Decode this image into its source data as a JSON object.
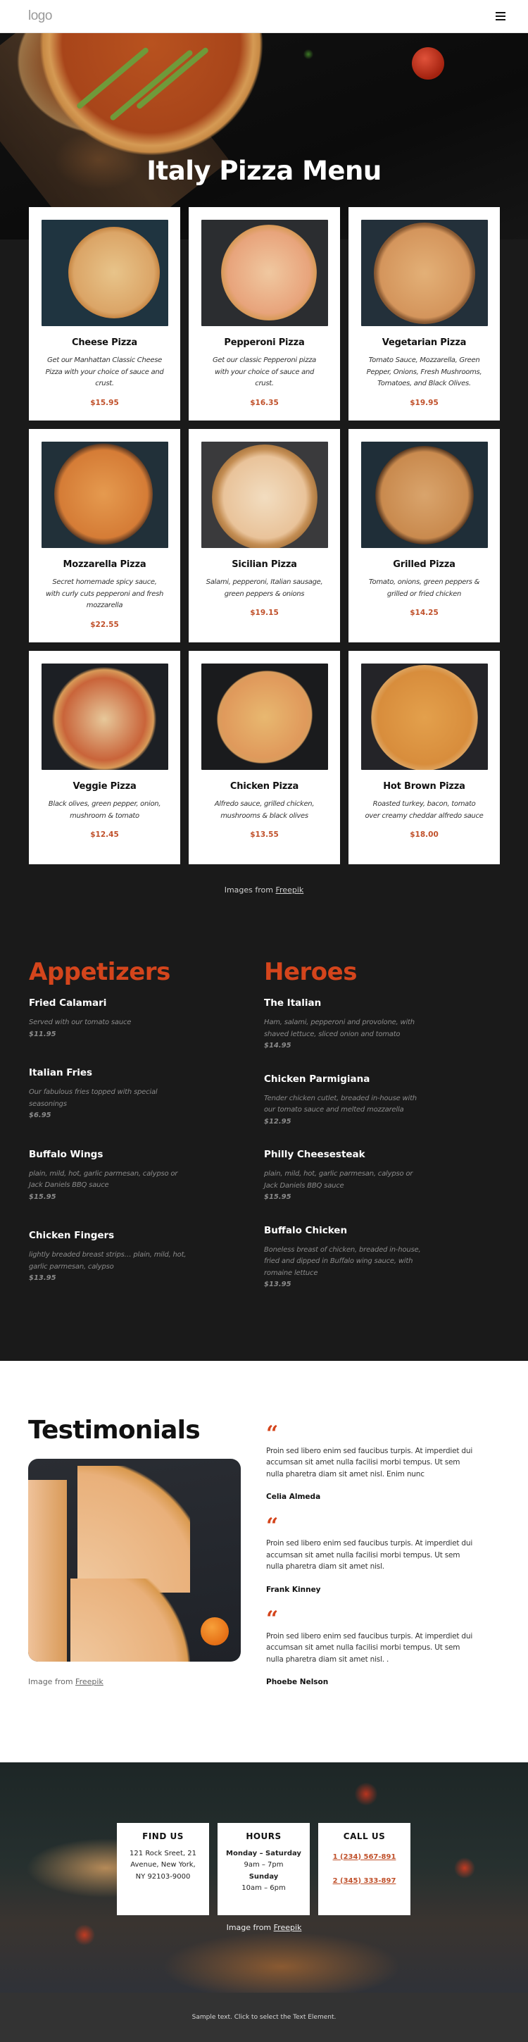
{
  "header": {
    "logo": "logo",
    "menu_icon": "hamburger-icon"
  },
  "hero": {
    "title": "Italy Pizza Menu"
  },
  "pizzas": [
    {
      "name": "Cheese Pizza",
      "description": "Get our Manhattan Classic Cheese Pizza with your choice of sauce and crust.",
      "price": "$15.95"
    },
    {
      "name": "Pepperoni Pizza",
      "description": "Get our classic Pepperoni pizza with your choice of sauce and crust.",
      "price": "$16.35"
    },
    {
      "name": "Vegetarian Pizza",
      "description": "Tomato Sauce, Mozzarella, Green Pepper, Onions, Fresh Mushrooms, Tomatoes, and Black Olives.",
      "price": "$19.95"
    },
    {
      "name": "Mozzarella Pizza",
      "description": "Secret homemade spicy sauce, with curly cuts pepperoni and fresh mozzarella",
      "price": "$22.55"
    },
    {
      "name": "Sicilian Pizza",
      "description": "Salami, pepperoni, Italian sausage, green peppers & onions",
      "price": "$19.15"
    },
    {
      "name": "Grilled Pizza",
      "description": "Tomato, onions, green peppers & grilled or fried chicken",
      "price": "$14.25"
    },
    {
      "name": "Veggie Pizza",
      "description": "Black olives, green pepper, onion, mushroom & tomato",
      "price": "$12.45"
    },
    {
      "name": "Chicken Pizza",
      "description": "Alfredo sauce, grilled chicken, mushrooms & black olives",
      "price": "$13.55"
    },
    {
      "name": "Hot Brown Pizza",
      "description": "Roasted turkey, bacon, tomato over creamy cheddar alfredo sauce",
      "price": "$18.00"
    }
  ],
  "menu_credit": {
    "prefix": "Images from ",
    "link": "Freepik"
  },
  "appetizers": {
    "heading": "Appetizers",
    "items": [
      {
        "name": "Fried Calamari",
        "description": "Served with our tomato sauce",
        "price": "$11.95"
      },
      {
        "name": "Italian Fries",
        "description": "Our fabulous fries topped with special seasonings",
        "price": "$6.95"
      },
      {
        "name": "Buffalo Wings",
        "description": "plain, mild, hot, garlic parmesan, calypso or Jack Daniels BBQ sauce",
        "price": "$15.95"
      },
      {
        "name": "Chicken Fingers",
        "description": "lightly breaded breast strips… plain, mild, hot, garlic parmesan, calypso",
        "price": "$13.95"
      }
    ]
  },
  "heroes": {
    "heading": "Heroes",
    "items": [
      {
        "name": "The Italian",
        "description": "Ham, salami, pepperoni and provolone, with shaved lettuce, sliced onion and tomato",
        "price": "$14.95"
      },
      {
        "name": "Chicken Parmigiana",
        "description": "Tender chicken cutlet, breaded in-house with our tomato sauce and melted mozzarella",
        "price": "$12.95"
      },
      {
        "name": "Philly Cheesesteak",
        "description": "plain, mild, hot, garlic parmesan, calypso or Jack Daniels BBQ sauce",
        "price": "$15.95"
      },
      {
        "name": "Buffalo Chicken",
        "description": "Boneless breast of chicken, breaded in-house, fried and dipped in Buffalo wing sauce, with romaine lettuce",
        "price": "$13.95"
      }
    ]
  },
  "testimonials": {
    "title": "Testimonials",
    "credit": {
      "prefix": "Image from ",
      "link": "Freepik"
    },
    "quote_mark": "“",
    "items": [
      {
        "text": "Proin sed libero enim sed faucibus turpis. At imperdiet dui accumsan sit amet nulla facilisi morbi tempus. Ut sem nulla pharetra diam sit amet nisl. Enim nunc",
        "author": "Celia Almeda"
      },
      {
        "text": "Proin sed libero enim sed faucibus turpis. At imperdiet dui accumsan sit amet nulla facilisi morbi tempus. Ut sem nulla pharetra diam sit amet nisl.",
        "author": "Frank Kinney"
      },
      {
        "text": "Proin sed libero enim sed faucibus turpis. At imperdiet dui accumsan sit amet nulla facilisi morbi tempus. Ut sem nulla pharetra diam sit amet nisl. .",
        "author": "Phoebe Nelson"
      }
    ]
  },
  "contact": {
    "find_us": {
      "title": "FIND US",
      "lines": [
        "121 Rock Sreet, 21",
        "Avenue, New York,",
        "NY 92103-9000"
      ]
    },
    "hours": {
      "title": "HOURS",
      "day1": "Monday – Saturday",
      "time1": "9am – 7pm",
      "day2": "Sunday",
      "time2": "10am – 6pm"
    },
    "call_us": {
      "title": "CALL US",
      "phones": [
        "1 (234) 567-891",
        "2 (345) 333-897"
      ]
    },
    "credit": {
      "prefix": "Image from ",
      "link": "Freepik"
    }
  },
  "footer": {
    "text": "Sample text. Click to select the Text Element."
  },
  "colors": {
    "accent": "#d4451c",
    "price": "#c0502a",
    "dark_bg": "#1a1a1a",
    "footer_bg": "#333333"
  }
}
